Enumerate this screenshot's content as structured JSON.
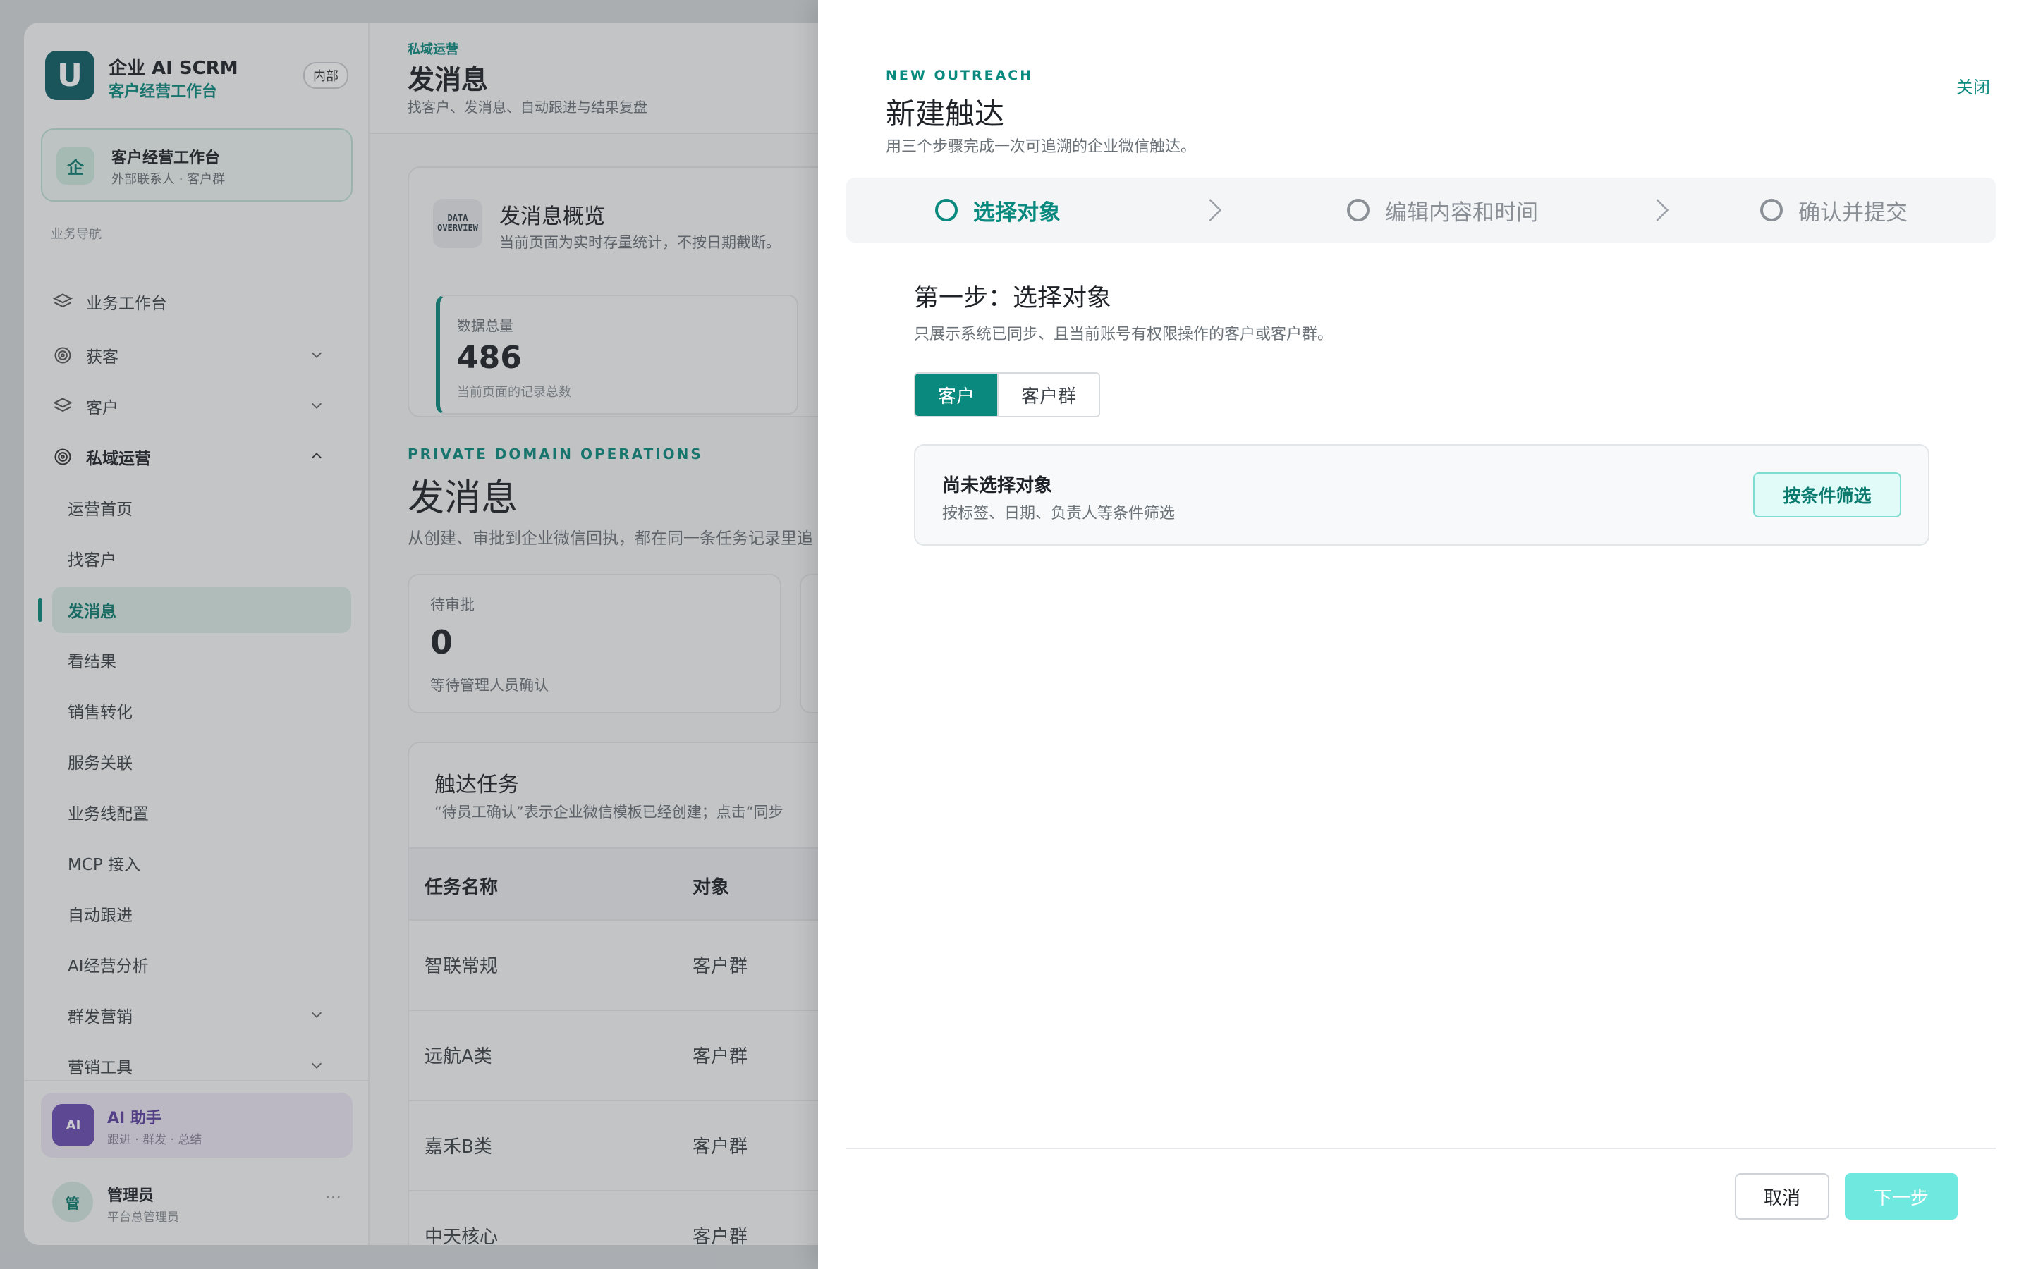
{
  "sidebar": {
    "brand_logo": "U",
    "brand_title": "企业 AI SCRM",
    "brand_subtitle": "客户经营工作台",
    "brand_badge": "内部",
    "workspace": {
      "icon": "企",
      "title": "客户经营工作台",
      "subtitle": "外部联系人 · 客户群"
    },
    "section_label": "业务导航",
    "items": [
      {
        "label": "业务工作台",
        "icon": "layers-icon"
      },
      {
        "label": "获客",
        "icon": "target-icon"
      },
      {
        "label": "客户",
        "icon": "layers-icon"
      },
      {
        "label": "私域运营",
        "icon": "target-icon"
      },
      {
        "label": "运营首页"
      },
      {
        "label": "找客户"
      },
      {
        "label": "发消息"
      },
      {
        "label": "看结果"
      },
      {
        "label": "销售转化"
      },
      {
        "label": "服务关联"
      },
      {
        "label": "业务线配置"
      },
      {
        "label": "MCP 接入"
      },
      {
        "label": "自动跟进"
      },
      {
        "label": "AI经营分析"
      },
      {
        "label": "群发营销"
      },
      {
        "label": "营销工具"
      }
    ],
    "ai_card": {
      "icon": "AI",
      "title": "AI 助手",
      "subtitle": "跟进 · 群发 · 总结"
    },
    "admin": {
      "avatar": "管",
      "name": "管理员",
      "role": "平台总管理员",
      "more": "···"
    }
  },
  "main": {
    "breadcrumb": "私域运营",
    "title": "发消息",
    "subtitle": "找客户、发消息、自动跟进与结果复盘",
    "overview": {
      "badge": "DATA OVERVIEW",
      "title": "发消息概览",
      "subtitle": "当前页面为实时存量统计，不按日期截断。",
      "stat_label": "数据总量",
      "stat_value": "486",
      "stat_note": "当前页面的记录总数"
    },
    "section_eyebrow": "PRIVATE DOMAIN OPERATIONS",
    "section_title": "发消息",
    "section_subtitle": "从创建、审批到企业微信回执，都在同一条任务记录里追",
    "pending": {
      "label": "待审批",
      "value": "0",
      "note": "等待管理人员确认"
    },
    "tasks": {
      "title": "触达任务",
      "subtitle": "“待员工确认”表示企业微信模板已经创建；点击“同步",
      "columns": [
        "任务名称",
        "对象"
      ],
      "rows": [
        [
          "智联常规",
          "客户群"
        ],
        [
          "远航A类",
          "客户群"
        ],
        [
          "嘉禾B类",
          "客户群"
        ],
        [
          "中天核心",
          "客户群"
        ]
      ]
    }
  },
  "drawer": {
    "eyebrow": "NEW OUTREACH",
    "title": "新建触达",
    "subtitle": "用三个步骤完成一次可追溯的企业微信触达。",
    "close_label": "关闭",
    "steps": [
      "选择对象",
      "编辑内容和时间",
      "确认并提交"
    ],
    "step_title": "第一步：选择对象",
    "step_subtitle": "只展示系统已同步、且当前账号有权限操作的客户或客户群。",
    "segments": [
      "客户",
      "客户群"
    ],
    "empty_title": "尚未选择对象",
    "empty_subtitle": "按标签、日期、负责人等条件筛选",
    "filter_button": "按条件筛选",
    "cancel_label": "取消",
    "next_label": "下一步"
  },
  "colors": {
    "accent": "#0a8a7e",
    "next_button": "#6fe8df",
    "ai_purple": "#6a4bb3"
  }
}
